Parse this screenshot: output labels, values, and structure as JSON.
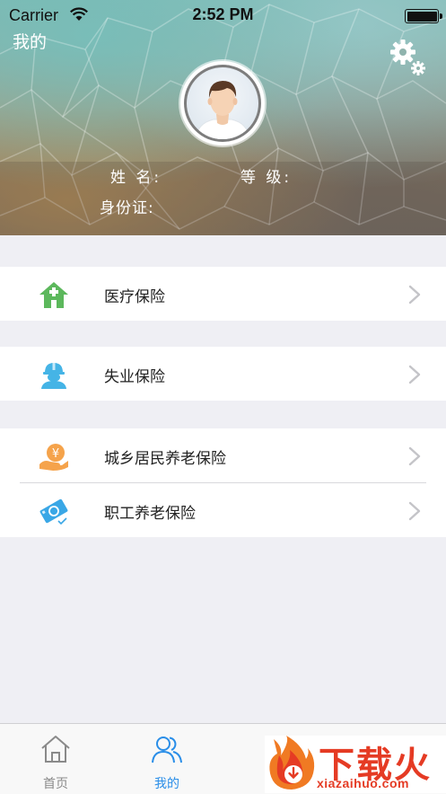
{
  "status_bar": {
    "carrier": "Carrier",
    "time": "2:52 PM"
  },
  "header": {
    "title": "我的",
    "settings_icon": "gear-icon",
    "avatar_icon": "user-avatar",
    "name_label": "姓 名:",
    "level_label": "等 级:",
    "id_label": "身份证:"
  },
  "menu": {
    "groups": [
      [
        {
          "label": "医疗保险",
          "icon": "house-cross-icon",
          "color": "#5cb85c"
        }
      ],
      [
        {
          "label": "失业保险",
          "icon": "worker-helmet-icon",
          "color": "#45b4e6"
        }
      ],
      [
        {
          "label": "城乡居民养老保险",
          "icon": "yuan-hand-icon",
          "color": "#f5a34b"
        },
        {
          "label": "职工养老保险",
          "icon": "card-check-icon",
          "color": "#3aa7e6"
        }
      ]
    ]
  },
  "tabbar": {
    "tabs": [
      {
        "label": "首页",
        "icon": "home-icon",
        "active": false
      },
      {
        "label": "我的",
        "icon": "users-icon",
        "active": true
      }
    ],
    "active_color": "#2a8ee8",
    "inactive_color": "#8a8a8a"
  },
  "watermark": {
    "title": "下载火",
    "url": "xiazaihuo.com"
  }
}
